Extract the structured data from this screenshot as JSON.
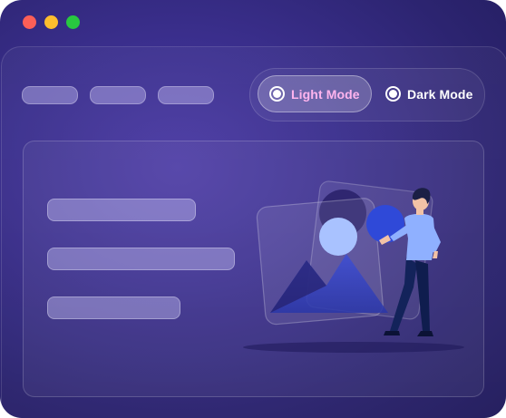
{
  "window": {
    "controls": [
      "close",
      "minimize",
      "maximize"
    ],
    "colors": {
      "close": "#fc5f57",
      "minimize": "#fdbd2e",
      "maximize": "#28c840"
    }
  },
  "nav": {
    "items": [
      "placeholder",
      "placeholder",
      "placeholder"
    ]
  },
  "theme_toggle": {
    "options": [
      {
        "label": "Light Mode",
        "selected": true
      },
      {
        "label": "Dark Mode",
        "selected": false
      }
    ],
    "accent": "#ffb4ee"
  },
  "panel": {
    "lines": [
      "placeholder",
      "placeholder",
      "placeholder"
    ],
    "illustration": "person-with-image-placeholder"
  }
}
